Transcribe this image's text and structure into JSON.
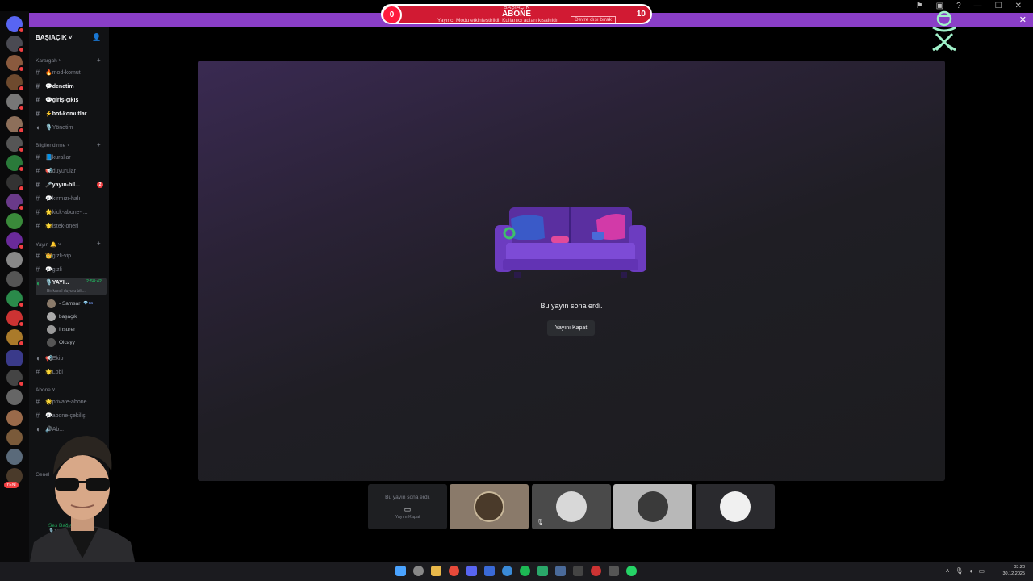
{
  "goal_widget": {
    "top_label": "BAŞIAÇIK",
    "title": "ABONE",
    "current": "0",
    "target": "10",
    "notice": "Yayıncı Modu etkinleştirildi. Kullanıcı adları kısaltıldı.",
    "disable_label": "Devre dışı bırak"
  },
  "server": {
    "name": "BAŞIAÇIK",
    "categories": [
      {
        "name": "Karargah",
        "channels": [
          {
            "label": "🔥mod-komut",
            "bold": false
          },
          {
            "label": "💬denetim",
            "bold": true
          },
          {
            "label": "💬giriş-çıkış",
            "bold": true
          },
          {
            "label": "⚡bot-komutlar",
            "bold": true
          },
          {
            "label": "🎙️Yönetim",
            "bold": false,
            "voice": true
          }
        ]
      },
      {
        "name": "Bilgilendirme",
        "channels": [
          {
            "label": "📘kurallar",
            "bold": false
          },
          {
            "label": "📢duyurular",
            "bold": false
          },
          {
            "label": "🎤yayın-bil...",
            "bold": true,
            "badge": "2"
          },
          {
            "label": "💬kırmızı-halı",
            "bold": false
          },
          {
            "label": "🌟kick-abone-r...",
            "bold": false
          },
          {
            "label": "🌟istek-öneri",
            "bold": false
          }
        ]
      },
      {
        "name": "Yayın 🔔",
        "channels": [
          {
            "label": "👑gizli-vip",
            "bold": false
          },
          {
            "label": "💬gizli",
            "bold": false
          },
          {
            "label": "🎙️YAYI...",
            "bold": true,
            "voice": true,
            "active": true,
            "time": "2:58:42"
          }
        ],
        "active_desc": "Bir kanal duyuru bili...",
        "members": [
          {
            "name": "- Samsar",
            "tag": "💎ca"
          },
          {
            "name": "başaçık",
            "tag": ""
          },
          {
            "name": "Insurer",
            "tag": ""
          },
          {
            "name": "Olcayy",
            "tag": ""
          }
        ],
        "extra_channels": [
          {
            "label": "📢Ekip",
            "voice": true
          },
          {
            "label": "🌟Lobi",
            "voice": false
          }
        ]
      },
      {
        "name": "Abone",
        "channels": [
          {
            "label": "🌟private-abone",
            "bold": false
          },
          {
            "label": "💬abone-çekiliş",
            "bold": false
          },
          {
            "label": "🔊Ab...",
            "bold": false,
            "voice": true
          }
        ]
      }
    ],
    "general_category": "Genel"
  },
  "voice_panel": {
    "status": "Ses Bağlantısı K...",
    "channel": "🎙️YAYIN ODASI / ...",
    "username": "ba..."
  },
  "new_badge": "YENİ",
  "stage": {
    "ended_text": "Bu yayın sona erdi.",
    "close_button": "Yayını Kapat"
  },
  "tiles": {
    "ended_text": "Bu yayın sona erdi.",
    "close_text": "Yayını Kapat"
  },
  "taskbar": {
    "time": "03:20",
    "date": "30.12.2025"
  }
}
